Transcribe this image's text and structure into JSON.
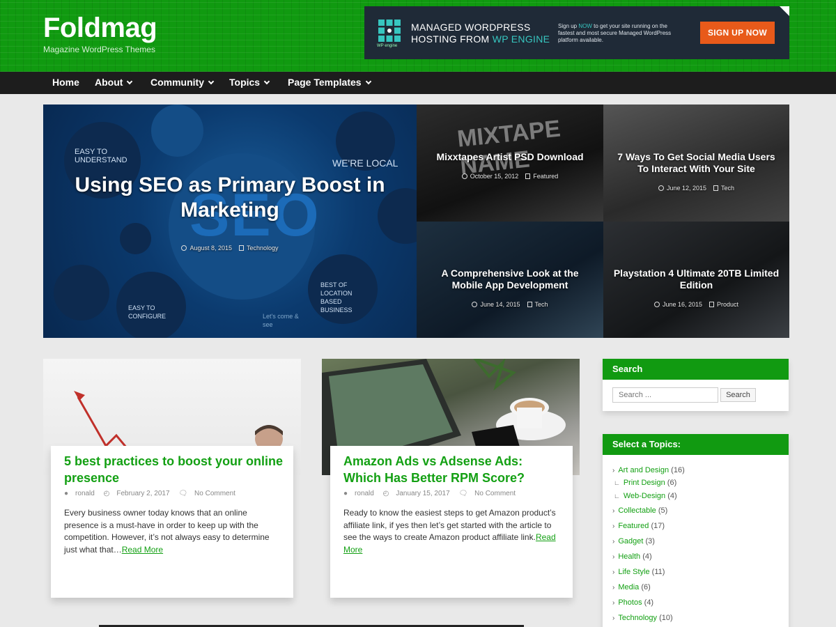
{
  "header": {
    "site_title": "Foldmag",
    "tagline": "Magazine WordPress Themes"
  },
  "ad": {
    "logo_text": "WP engine",
    "headline_part1": "MANAGED WORDPRESS",
    "headline_part2": "HOSTING FROM ",
    "headline_highlight": "WP ENGINE",
    "body_part1": "Sign up ",
    "body_highlight": "NOW",
    "body_part2": " to get your site running on the fastest and most secure Managed WordPress platform available.",
    "cta": "SIGN UP NOW"
  },
  "nav": {
    "items": [
      {
        "label": "Home"
      },
      {
        "label": "About"
      },
      {
        "label": "Community"
      },
      {
        "label": "Topics"
      },
      {
        "label": "Page Templates"
      }
    ]
  },
  "hero": {
    "main": {
      "title": "Using SEO as Primary Boost in Marketing",
      "date": "August 8, 2015",
      "category": "Technology"
    },
    "graphic_text": {
      "seo": "SEO",
      "easy_understand": "EASY TO UNDERSTAND",
      "local": "WE'RE LOCAL",
      "best_location": "BEST OF LOCATION BASED BUSINESS",
      "easy_configure": "EASY TO CONFIGURE",
      "lets_come": "Let's come & see"
    },
    "tiles": [
      {
        "title": "Mixxtapes Artist PSD Download",
        "date": "October 15, 2012",
        "category": "Featured",
        "graphic": "MIXTAPE NAME"
      },
      {
        "title": "7 Ways To Get Social Media Users To Interact With Your Site",
        "date": "June 12, 2015",
        "category": "Tech"
      },
      {
        "title": "A Comprehensive Look at the Mobile App Development",
        "date": "June 14, 2015",
        "category": "Tech"
      },
      {
        "title": "Playstation 4 Ultimate 20TB Limited Edition",
        "date": "June 16, 2015",
        "category": "Product"
      }
    ]
  },
  "posts": [
    {
      "title": "5 best practices to boost your online presence",
      "author": "ronald",
      "date": "February 2, 2017",
      "comments": "No Comment",
      "excerpt": "Every business owner today knows that an online presence is a must-have in order to keep up with the competition. However, it’s not always easy to determine just what that…",
      "read_more": "Read More"
    },
    {
      "title": "Amazon Ads vs Adsense Ads: Which Has Better RPM Score?",
      "author": "ronald",
      "date": "January 15, 2017",
      "comments": "No Comment",
      "excerpt": "Ready to know the easiest steps to get Amazon product’s affiliate link, if yes then let’s get started with the article to see the ways to create Amazon product affiliate link.",
      "read_more": "Read More"
    }
  ],
  "sidebar": {
    "search": {
      "title": "Search",
      "placeholder": "Search ...",
      "button": "Search"
    },
    "topics": {
      "title": "Select a Topics:",
      "items": [
        {
          "label": "Art and Design",
          "count": "(16)"
        },
        {
          "label": "Print Design",
          "count": "(6)"
        },
        {
          "label": "Web-Design",
          "count": "(4)"
        },
        {
          "label": "Collectable",
          "count": "(5)"
        },
        {
          "label": "Featured",
          "count": "(17)"
        },
        {
          "label": "Gadget",
          "count": "(3)"
        },
        {
          "label": "Health",
          "count": "(4)"
        },
        {
          "label": "Life Style",
          "count": "(11)"
        },
        {
          "label": "Media",
          "count": "(6)"
        },
        {
          "label": "Photos",
          "count": "(4)"
        },
        {
          "label": "Technology",
          "count": "(10)"
        }
      ]
    }
  },
  "colors": {
    "accent": "#119a11",
    "header_bg": "#109a10",
    "nav_bg": "#1d1d1d",
    "cta": "#e85a1a"
  }
}
